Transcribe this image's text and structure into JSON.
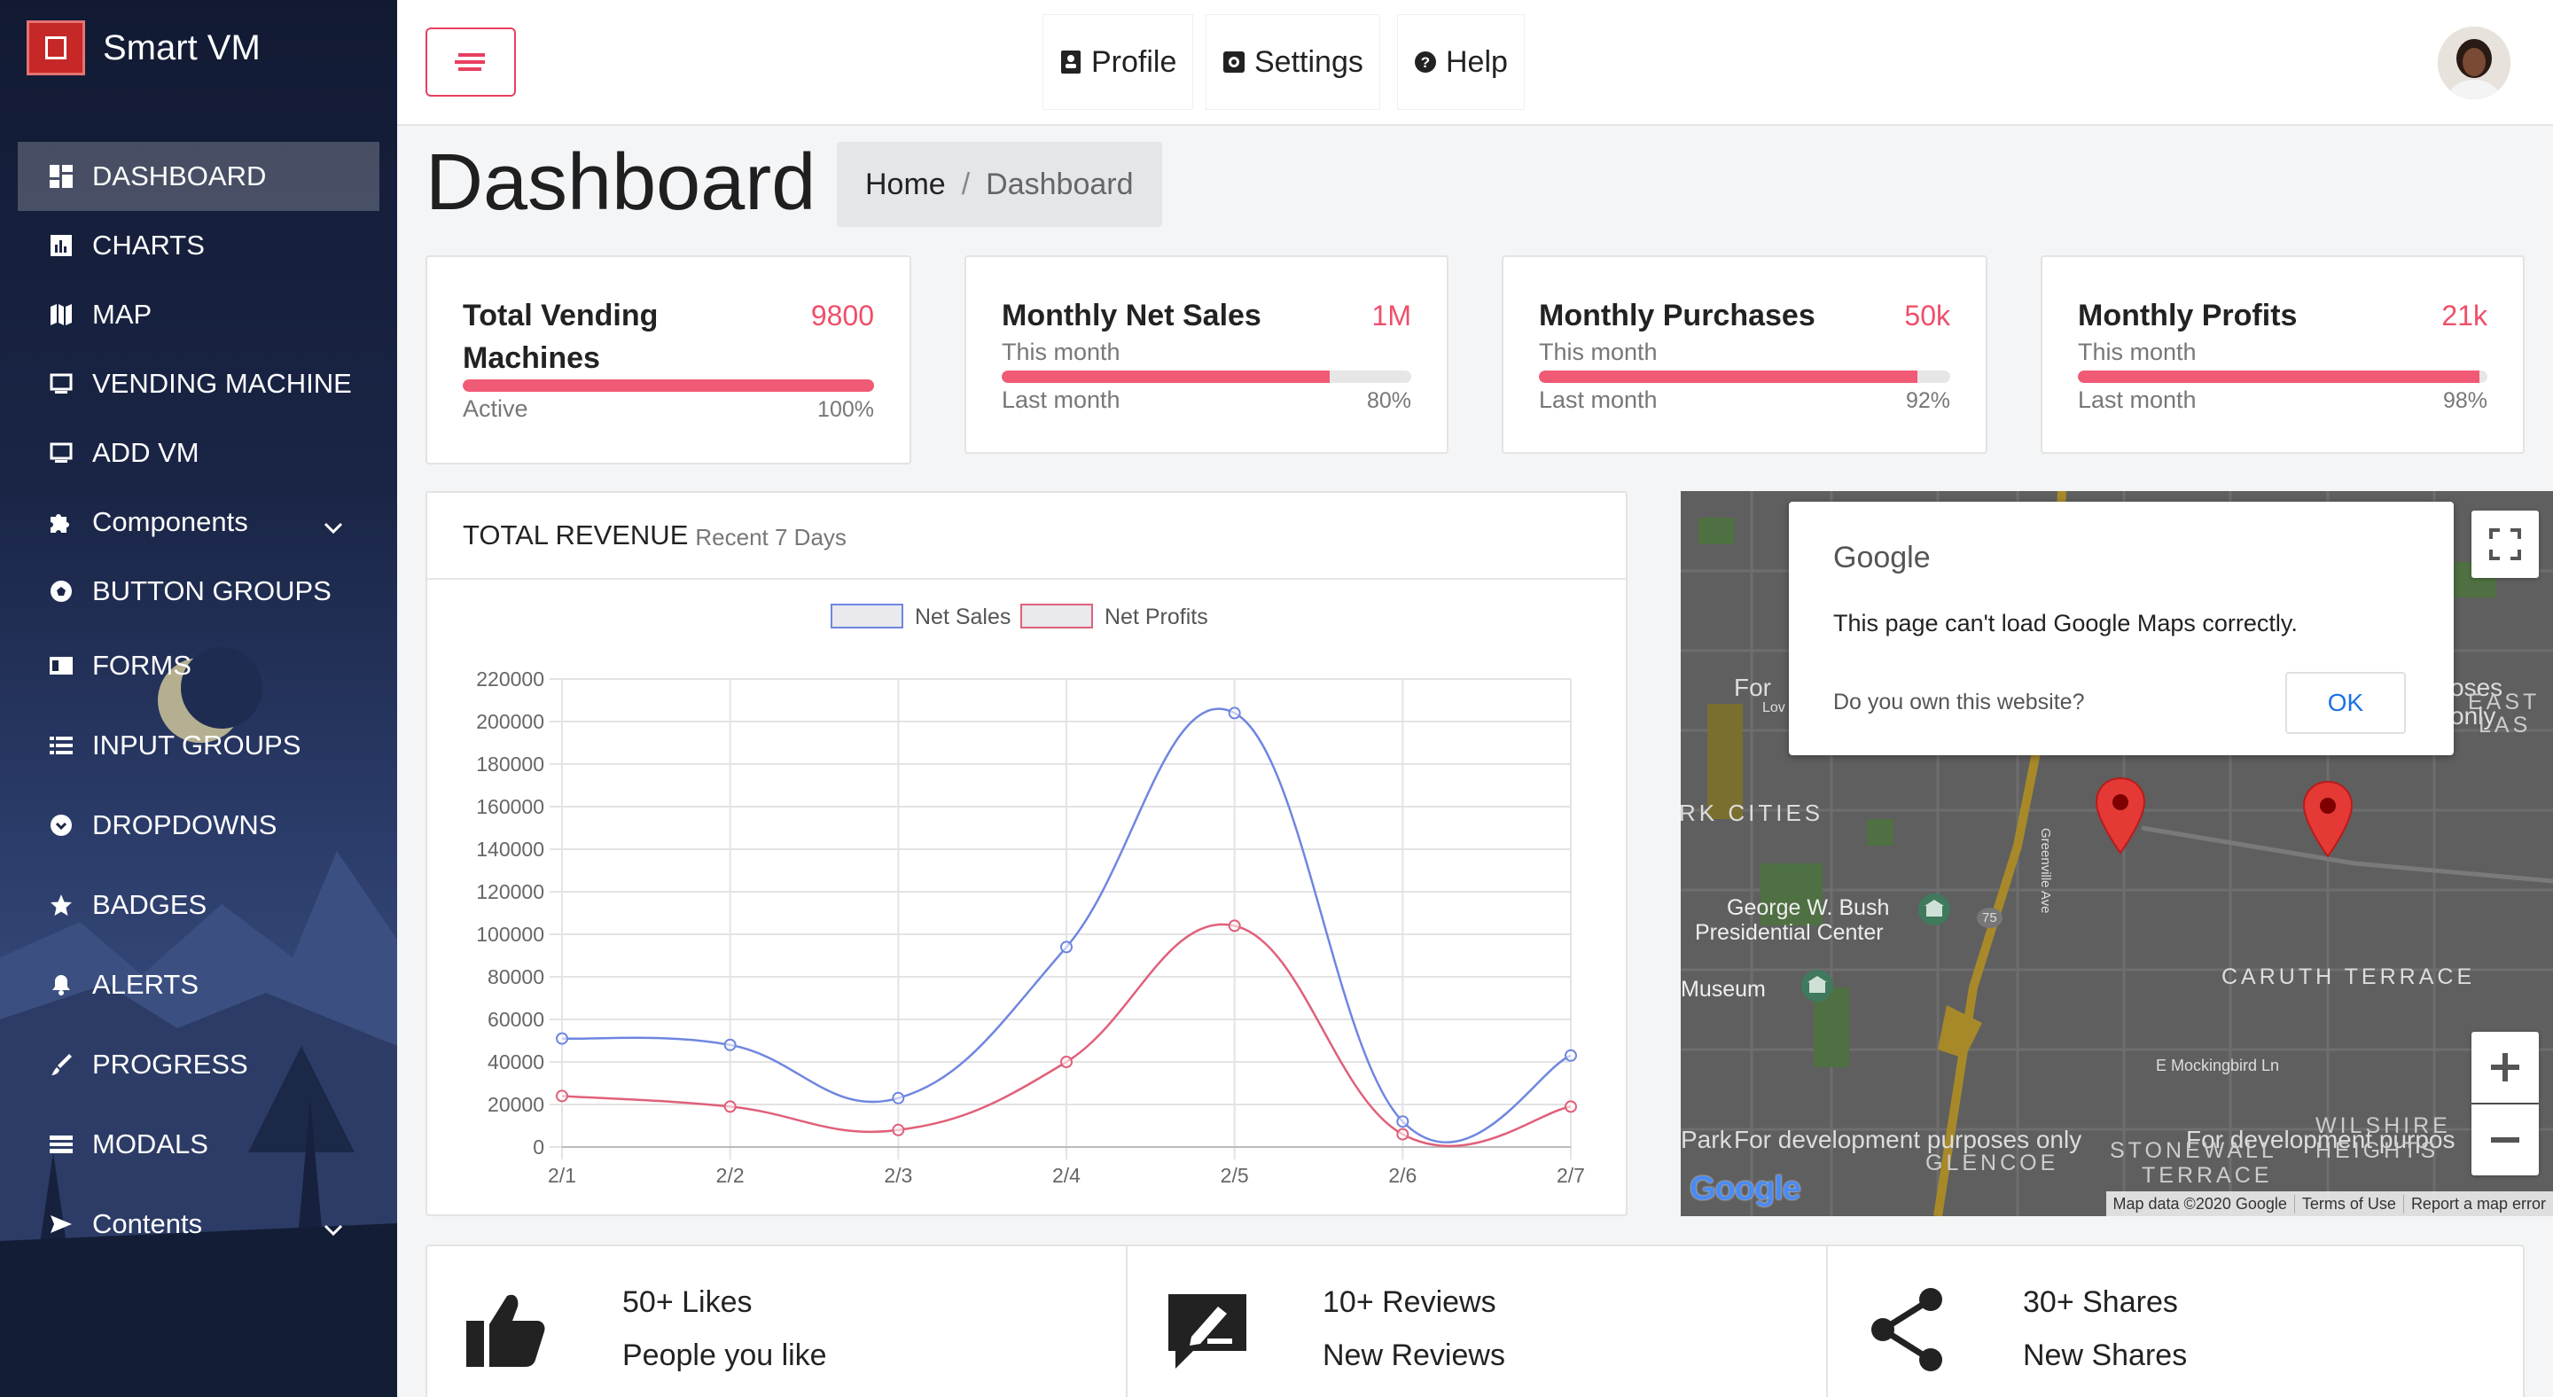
{
  "app": {
    "name": "Smart VM"
  },
  "sidebar": {
    "items": [
      {
        "label": "DASHBOARD",
        "icon": "dashboard-icon",
        "active": true
      },
      {
        "label": "CHARTS",
        "icon": "bar-chart-icon"
      },
      {
        "label": "MAP",
        "icon": "map-icon"
      },
      {
        "label": "VENDING MACHINE",
        "icon": "monitor-icon"
      },
      {
        "label": "ADD VM",
        "icon": "monitor-icon"
      },
      {
        "label": "Components",
        "icon": "puzzle-icon",
        "expandable": true
      },
      {
        "label": "BUTTON GROUPS",
        "icon": "soccer-ball-icon"
      },
      {
        "label": "FORMS",
        "icon": "form-icon"
      },
      {
        "label": "INPUT GROUPS",
        "icon": "list-icon"
      },
      {
        "label": "DROPDOWNS",
        "icon": "chevron-circle-icon"
      },
      {
        "label": "BADGES",
        "icon": "star-icon"
      },
      {
        "label": "ALERTS",
        "icon": "bell-icon"
      },
      {
        "label": "PROGRESS",
        "icon": "brush-icon"
      },
      {
        "label": "MODALS",
        "icon": "window-icon"
      },
      {
        "label": "Contents",
        "icon": "send-icon",
        "expandable": true
      }
    ]
  },
  "topbar": {
    "profile": "Profile",
    "settings": "Settings",
    "help": "Help"
  },
  "page": {
    "title": "Dashboard",
    "breadcrumb": {
      "home": "Home",
      "separator": "/",
      "current": "Dashboard"
    }
  },
  "stats": [
    {
      "title": "Total Vending Machines",
      "value": "9800",
      "sub": "",
      "foot_left": "Active",
      "foot_right": "100%",
      "progress": 1.0
    },
    {
      "title": "Monthly Net Sales",
      "value": "1M",
      "sub": "This month",
      "foot_left": "Last month",
      "foot_right": "80%",
      "progress": 0.8
    },
    {
      "title": "Monthly Purchases",
      "value": "50k",
      "sub": "This month",
      "foot_left": "Last month",
      "foot_right": "92%",
      "progress": 0.92
    },
    {
      "title": "Monthly Profits",
      "value": "21k",
      "sub": "This month",
      "foot_left": "Last month",
      "foot_right": "98%",
      "progress": 0.98
    }
  ],
  "revenue": {
    "title": "TOTAL REVENUE",
    "subtitle": "Recent 7 Days"
  },
  "chart_data": {
    "type": "line",
    "categories": [
      "2/1",
      "2/2",
      "2/3",
      "2/4",
      "2/5",
      "2/6",
      "2/7"
    ],
    "series": [
      {
        "name": "Net Sales",
        "values": [
          51000,
          48000,
          23000,
          94000,
          204000,
          12000,
          43000
        ],
        "color": "#6f86e0"
      },
      {
        "name": "Net Profits",
        "values": [
          24000,
          19000,
          8000,
          40000,
          104000,
          6000,
          19000
        ],
        "color": "#e0607a"
      }
    ],
    "ylim": [
      0,
      220000
    ],
    "yticks": [
      "0",
      "20000",
      "40000",
      "60000",
      "80000",
      "100000",
      "120000",
      "140000",
      "160000",
      "180000",
      "200000",
      "220000"
    ],
    "legend": "top",
    "grid": true
  },
  "map": {
    "dialog_brand": "Google",
    "dialog_message": "This page can't load Google Maps correctly.",
    "dialog_question": "Do you own this website?",
    "ok_label": "OK",
    "labels": [
      "RK CITIES",
      "George W. Bush",
      "Presidential Center",
      "Museum",
      "CARUTH TERRACE",
      "E Mockingbird Ln",
      "For development purposes only",
      "For development purpos",
      "GLENCOE",
      "STONEWALL",
      "TERRACE",
      "WILSHIRE",
      "HEIGHTS",
      "Greenville Ave",
      "For",
      "Lov",
      "oses only",
      "EAST",
      "LAS",
      "Park",
      "75"
    ],
    "logo": "Google",
    "footer": [
      "Map data ©2020 Google",
      "Terms of Use",
      "Report a map error"
    ]
  },
  "social": [
    {
      "line1": "50+ Likes",
      "line2": "People you like",
      "icon": "thumbs-up-icon"
    },
    {
      "line1": "10+ Reviews",
      "line2": "New Reviews",
      "icon": "review-icon"
    },
    {
      "line1": "30+ Shares",
      "line2": "New Shares",
      "icon": "share-icon"
    }
  ],
  "colors": {
    "accent": "#ef4f6a",
    "sidebar": "#1a2546",
    "net_sales": "#6f86e0",
    "net_profits": "#e0607a"
  }
}
